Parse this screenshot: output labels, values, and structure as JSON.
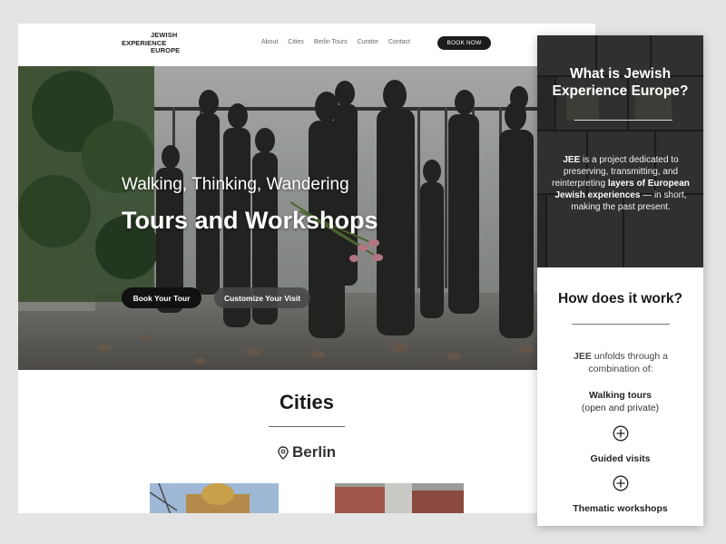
{
  "desktop": {
    "nav": {
      "logo": [
        "JEWISH",
        "EXPERIENCE",
        "EUROPE"
      ],
      "links": [
        "About",
        "Cities",
        "Berlin Tours",
        "Curator",
        "Contact"
      ],
      "cta": "BOOK NOW"
    },
    "hero": {
      "subtitle": "Walking, Thinking, Wandering",
      "title": "Tours and Workshops",
      "primary_button": "Book Your Tour",
      "secondary_button": "Customize Your Visit"
    },
    "cities": {
      "title": "Cities",
      "city": "Berlin",
      "city_icon": "map-pin-icon"
    }
  },
  "mobile": {
    "what_title": "What is Jewish Experience Europe?",
    "desc_abbr": "JEE",
    "desc_1": " is a project dedicated to preserving, transmitting, and reinterpreting ",
    "desc_bold": "layers of European Jewish experiences",
    "desc_2": " — in short, making the past present.",
    "how_title": "How does it work?",
    "unfolds_abbr": "JEE",
    "unfolds_text": " unfolds through a combination of:",
    "step1_title": "Walking tours",
    "step1_sub": "(open and private)",
    "step2_title": "Guided visits",
    "step3_title": "Thematic workshops",
    "plus_icon": "plus-circle-icon"
  },
  "colors": {
    "background": "#e4e4e4",
    "button_dark": "#111111",
    "text_dark": "#1a1a1a"
  }
}
